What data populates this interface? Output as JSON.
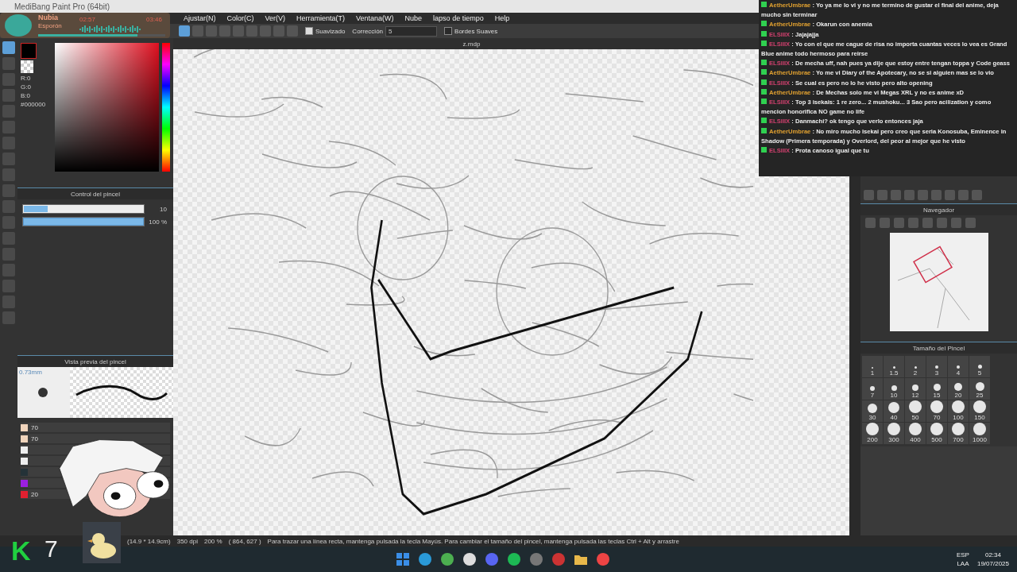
{
  "window": {
    "title": "MediBang Paint Pro (64bit)"
  },
  "menu": [
    "Ajustar(N)",
    "Color(C)",
    "Ver(V)",
    "Herramienta(T)",
    "Ventana(W)",
    "Nube",
    "lapso de tiempo",
    "Help"
  ],
  "toolbar": {
    "tools": [
      {
        "selected": true
      },
      {
        "selected": false
      },
      {
        "selected": false
      },
      {
        "selected": false
      },
      {
        "selected": false
      },
      {
        "selected": false
      },
      {
        "selected": false
      },
      {
        "selected": false
      },
      {
        "selected": false
      }
    ],
    "smoothing": {
      "label": "Suavizado",
      "checked": true
    },
    "correction": {
      "label": "Corrección",
      "value": "5"
    },
    "soft_edges": {
      "label": "Bordes Suaves",
      "checked": false
    }
  },
  "document_tab": "z.mdp",
  "tool_strip": [
    {
      "selected": true
    },
    {
      "selected": false
    },
    {
      "selected": false
    },
    {
      "selected": false
    },
    {
      "selected": false
    },
    {
      "selected": false
    },
    {
      "selected": false
    },
    {
      "selected": false
    },
    {
      "selected": false
    },
    {
      "selected": false
    },
    {
      "selected": false
    },
    {
      "selected": false
    },
    {
      "selected": false
    },
    {
      "selected": false
    },
    {
      "selected": false
    },
    {
      "selected": false
    },
    {
      "selected": false
    },
    {
      "selected": false
    }
  ],
  "color_panel": {
    "rgb": [
      "R:0",
      "G:0",
      "B:0"
    ],
    "hex": "#000000"
  },
  "brush_control": {
    "title": "Control del pincel",
    "size": {
      "level": 0.2,
      "reading": "10"
    },
    "opacity": {
      "level": 1.0,
      "reading": "100 %"
    }
  },
  "brush_preview": {
    "title": "Vista previa del pincel",
    "size": "0.73mm"
  },
  "color_list": [
    {
      "color": "#f0d4bc",
      "label": "70"
    },
    {
      "color": "#f0d4bc",
      "label": "70"
    },
    {
      "color": "#eeeeee"
    },
    {
      "color": "#eeeeee"
    },
    {
      "color": "#243238"
    },
    {
      "color": "#9b1fe0"
    },
    {
      "color": "#e02030",
      "label": "20"
    }
  ],
  "navigator": {
    "title": "Navegador"
  },
  "brush_size": {
    "title": "Tamaño del Pincel",
    "sizes": [
      "1",
      "1.5",
      "2",
      "3",
      "4",
      "5",
      "7",
      "10",
      "12",
      "15",
      "20",
      "25",
      "30",
      "40",
      "50",
      "70",
      "100",
      "150",
      "200",
      "300",
      "400",
      "500",
      "700",
      "1000"
    ]
  },
  "status_bar": [
    "(14.9 * 14.9cm)",
    "350 dpi",
    "200 %",
    "( 864, 627 )",
    "Para trazar una línea recta, mantenga pulsada la tecla Mayús. Para cambiar el tamaño del pincel, mantenga pulsada las teclas Ctrl + Alt y arrastre"
  ],
  "media_player": {
    "title": "Nubia",
    "artist": "Esporón",
    "elapsed": "02:57",
    "total": "03:46",
    "level": 0.78
  },
  "chat": [
    {
      "user": "AetherUmbrae",
      "color": "#e0a030",
      "separator": ":",
      "lines": [
        "Yo ya me lo vi y no me termino de gustar el final del anime, deja",
        "mucho sin terminar"
      ]
    },
    {
      "user": "AetherUmbrae",
      "color": "#e0a030",
      "separator": ":",
      "lines": [
        "Okarun con anemia"
      ]
    },
    {
      "user": "ELSIIIX",
      "color": "#d0406e",
      "separator": ":",
      "lines": [
        "Jajajajja"
      ]
    },
    {
      "user": "ELSIIIX",
      "color": "#d0406e",
      "separator": ":",
      "lines": [
        "Yo con el que me cague de risa no importa cuantas veces lo vea es Grand",
        "Blue anime todo hermoso para reirse"
      ]
    },
    {
      "user": "ELSIIIX",
      "color": "#d0406e",
      "separator": ":",
      "lines": [
        "De mecha uff, nah pues ya dije que estoy entre tengan toppa y Code geass"
      ]
    },
    {
      "user": "AetherUmbrae",
      "color": "#e0a030",
      "separator": ":",
      "lines": [
        "Yo me vi Diary of the Apotecary, no se si alguien mas se lo vio"
      ]
    },
    {
      "user": "ELSIIIX",
      "color": "#d0406e",
      "separator": ":",
      "lines": [
        "Se cual es pero no lo he visto pero alto opening"
      ]
    },
    {
      "user": "AetherUmbrae",
      "color": "#e0a030",
      "separator": ":",
      "lines": [
        "De Mechas solo me vi Megas XRL y no es anime xD"
      ]
    },
    {
      "user": "ELSIIIX",
      "color": "#d0406e",
      "separator": ":",
      "lines": [
        "Top 3 isekais: 1 re zero... 2 mushoku... 3 Sao pero acilization y como",
        "mencion honorifica NO game no life"
      ]
    },
    {
      "user": "ELSIIIX",
      "color": "#d0406e",
      "separator": ":",
      "lines": [
        "Danmachi? ok tengo que verlo entonces jaja"
      ]
    },
    {
      "user": "AetherUmbrae",
      "color": "#e0a030",
      "separator": ":",
      "lines": [
        "No miro mucho isekai pero creo que seria Konosuba, Eminence in",
        "Shadow (Primera temporada) y Overlord, del peor al mejor que he visto"
      ]
    },
    {
      "user": "ELSIIIX",
      "color": "#d0406e",
      "separator": ":",
      "lines": [
        "Prota canoso igual que tu"
      ]
    }
  ],
  "stream_overlay": {
    "logo": "K",
    "number": "7"
  },
  "taskbar": {
    "language": "ESP",
    "region": "LAA",
    "time": "02:34",
    "date": "19/07/2025"
  }
}
